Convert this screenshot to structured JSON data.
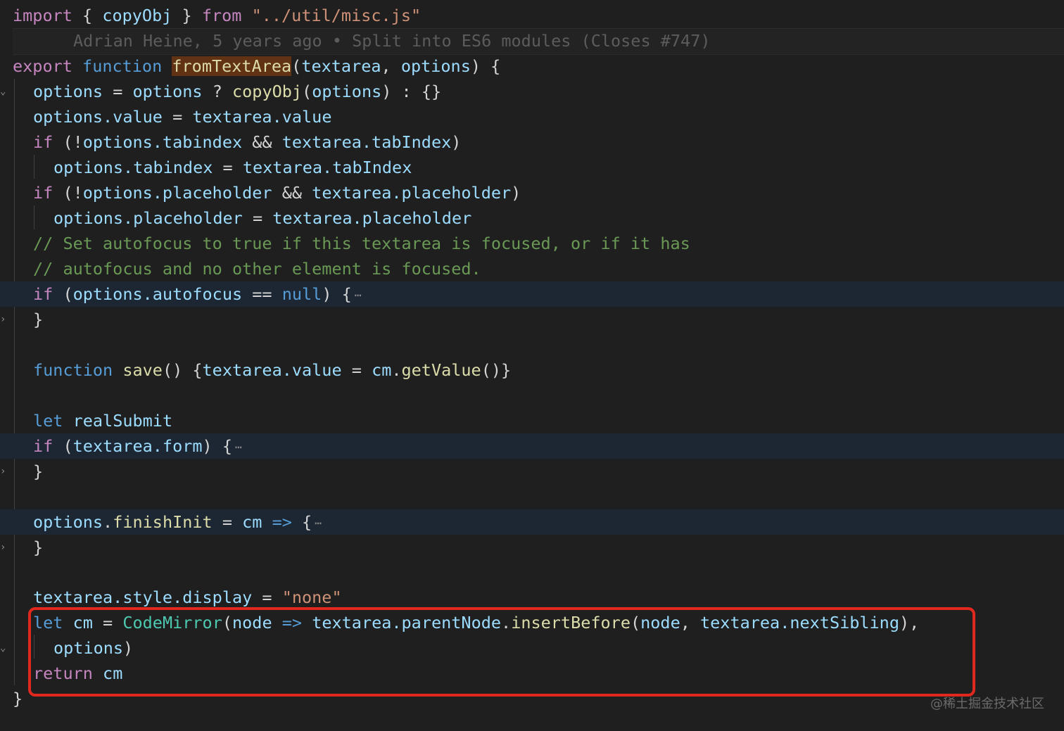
{
  "lines": {
    "l1": {
      "kw_import": "import",
      "p1": " { ",
      "name": "copyObj",
      "p2": " } ",
      "kw_from": "from",
      "p3": " ",
      "path": "\"../util/misc.js\""
    },
    "blame": "Adrian Heine, 5 years ago • Split into ES6 modules (Closes #747)",
    "l3": {
      "kw_export": "export",
      "p1": " ",
      "kw_function": "function",
      "p2": " ",
      "fname": "fromTextArea",
      "p3": "(",
      "a1": "textarea",
      "p4": ", ",
      "a2": "options",
      "p5": ") {"
    },
    "l4": {
      "v1": "options",
      "p1": " = ",
      "v2": "options",
      "p2": " ? ",
      "f": "copyObj",
      "p3": "(",
      "v3": "options",
      "p4": ") : {}"
    },
    "l5": {
      "v1": "options.value",
      "p1": " = ",
      "v2": "textarea.value"
    },
    "l6": {
      "kw": "if",
      "p1": " (!",
      "v1": "options.tabindex",
      "p2": " && ",
      "v2": "textarea.tabIndex",
      "p3": ")"
    },
    "l7": {
      "v1": "options.tabindex",
      "p1": " = ",
      "v2": "textarea.tabIndex"
    },
    "l8": {
      "kw": "if",
      "p1": " (!",
      "v1": "options.placeholder",
      "p2": " && ",
      "v2": "textarea.placeholder",
      "p3": ")"
    },
    "l9": {
      "v1": "options.placeholder",
      "p1": " = ",
      "v2": "textarea.placeholder"
    },
    "l10": "// Set autofocus to true if this textarea is focused, or if it has",
    "l11": "// autofocus and no other element is focused.",
    "l12": {
      "kw": "if",
      "p1": " (",
      "v1": "options.autofocus",
      "p2": " == ",
      "nul": "null",
      "p3": ") {",
      "dots": "⋯"
    },
    "l13": "}",
    "l15": {
      "kw": "function",
      "p1": " ",
      "f": "save",
      "p2": "() {",
      "v1": "textarea.value",
      "p3": " = ",
      "v2": "cm",
      "p4": ".",
      "f2": "getValue",
      "p5": "()}"
    },
    "l17": {
      "kw": "let",
      "p1": " ",
      "v1": "realSubmit"
    },
    "l18": {
      "kw": "if",
      "p1": " (",
      "v1": "textarea.form",
      "p2": ") {",
      "dots": "⋯"
    },
    "l19": "}",
    "l21": {
      "v1": "options",
      "p1": ".",
      "f": "finishInit",
      "p2": " = ",
      "v2": "cm",
      "p3": " ",
      "arrow": "=>",
      "p4": " {",
      "dots": "⋯"
    },
    "l22": "}",
    "l24": {
      "v1": "textarea.style.display",
      "p1": " = ",
      "s": "\"none\""
    },
    "l25": {
      "kw": "let",
      "p1": " ",
      "v1": "cm",
      "p2": " = ",
      "ty": "CodeMirror",
      "p3": "(",
      "v2": "node",
      "p4": " ",
      "arrow": "=>",
      "p5": " ",
      "v3": "textarea.parentNode",
      "p6": ".",
      "f": "insertBefore",
      "p7": "(",
      "v4": "node",
      "p8": ", ",
      "v5": "textarea.nextSibling",
      "p9": "),"
    },
    "l26": {
      "v1": "options",
      "p1": ")"
    },
    "l27": {
      "kw": "return",
      "p1": " ",
      "v1": "cm"
    },
    "l28": "}"
  },
  "watermark": "@稀土掘金技术社区",
  "colors": {
    "background": "#1f1f1f",
    "keyword_control": "#c586c0",
    "keyword_storage": "#569cd6",
    "function": "#dcdcaa",
    "variable": "#9cdcfe",
    "string": "#ce9178",
    "comment": "#6a9955",
    "type": "#4ec9b0",
    "highlight_box": "#e0281f"
  }
}
